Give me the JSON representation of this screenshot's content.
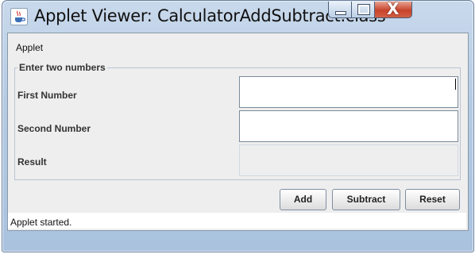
{
  "window": {
    "title": "Applet Viewer: CalculatorAddSubtract.class",
    "icon": "java-cup-icon",
    "controls": [
      "minimize",
      "maximize",
      "close"
    ],
    "close_glyph": "X"
  },
  "applet": {
    "menu_label": "Applet",
    "group_title": "Enter two numbers",
    "first_label": "First Number",
    "first_value": "",
    "second_label": "Second Number",
    "second_value": "",
    "result_label": "Result",
    "result_value": ""
  },
  "buttons": {
    "add": "Add",
    "subtract": "Subtract",
    "reset": "Reset"
  },
  "status": {
    "text": "Applet started."
  },
  "colors": {
    "titlebar": "#b5cbe3",
    "close_button": "#c7442b",
    "client_background": "#eeeeee"
  }
}
